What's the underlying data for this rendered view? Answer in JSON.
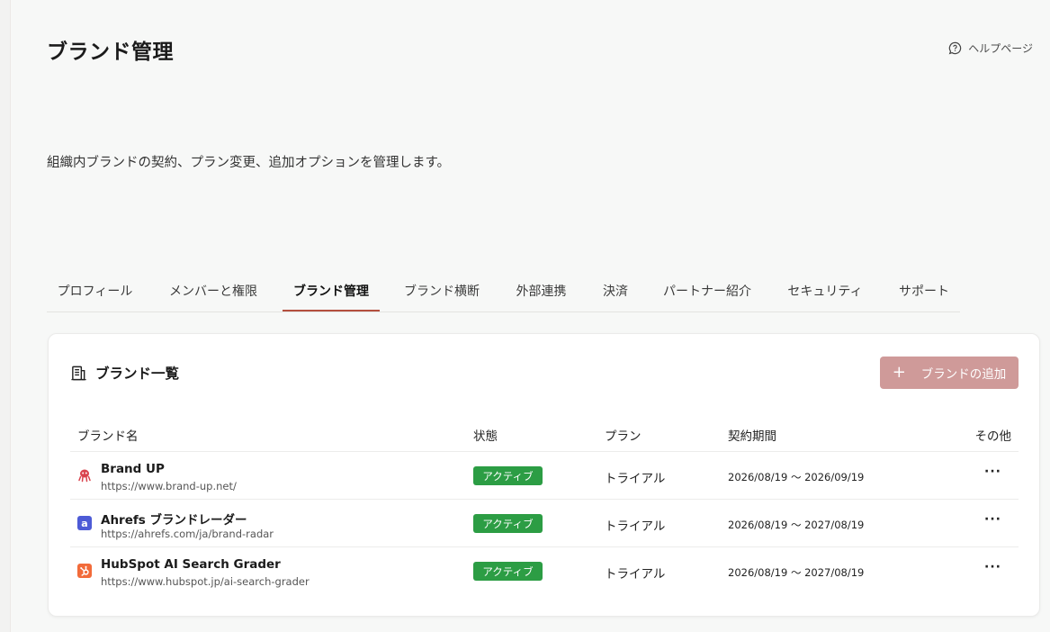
{
  "header": {
    "title": "ブランド管理",
    "help_label": "ヘルプページ",
    "subtitle": "組織内ブランドの契約、プラン変更、追加オプションを管理します。"
  },
  "tabs": [
    {
      "label": "プロフィール",
      "active": false
    },
    {
      "label": "メンバーと権限",
      "active": false
    },
    {
      "label": "ブランド管理",
      "active": true
    },
    {
      "label": "ブランド横断",
      "active": false
    },
    {
      "label": "外部連携",
      "active": false
    },
    {
      "label": "決済",
      "active": false
    },
    {
      "label": "パートナー紹介",
      "active": false
    },
    {
      "label": "セキュリティ",
      "active": false
    },
    {
      "label": "サポート",
      "active": false
    }
  ],
  "card": {
    "title": "ブランド一覧",
    "add_button_label": "ブランドの追加",
    "add_button_icon": "+"
  },
  "table": {
    "headers": {
      "name": "ブランド名",
      "status": "状態",
      "plan": "プラン",
      "period": "契約期間",
      "other": "その他"
    },
    "rows": [
      {
        "icon": "octopus-icon",
        "icon_color": "#d9434d",
        "name": "Brand UP",
        "url": "https://www.brand-up.net/",
        "status": "アクティブ",
        "plan": "トライアル",
        "period": "2026/08/19 ～ 2026/09/19",
        "more": "···"
      },
      {
        "icon": "ahrefs-icon",
        "icon_color": "#4d5bd6",
        "icon_letter": "a",
        "name": "Ahrefs ブランドレーダー",
        "url": "https://ahrefs.com/ja/brand-radar",
        "status": "アクティブ",
        "plan": "トライアル",
        "period": "2026/08/19 ～ 2027/08/19",
        "more": "···"
      },
      {
        "icon": "hubspot-icon",
        "icon_color": "#f26b3a",
        "name": "HubSpot AI Search Grader",
        "url": "https://www.hubspot.jp/ai-search-grader",
        "status": "アクティブ",
        "plan": "トライアル",
        "period": "2026/08/19 ～ 2027/08/19",
        "more": "···"
      }
    ]
  },
  "colors": {
    "accent": "#b4503f",
    "add_button": "#cf9a99",
    "status_active": "#2c9d44"
  }
}
